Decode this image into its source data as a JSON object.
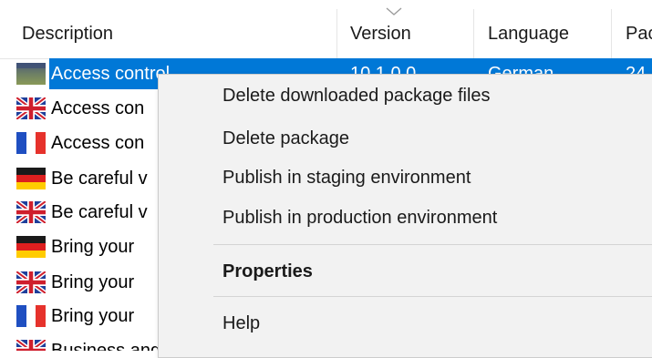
{
  "columns": [
    {
      "label": "Description"
    },
    {
      "label": "Version"
    },
    {
      "label": "Language"
    },
    {
      "label": "Pac"
    }
  ],
  "rows": [
    {
      "description": "Access control",
      "version": "10.1.0.0",
      "language": "German",
      "pack": "24",
      "flag": "multi",
      "selected": true
    },
    {
      "description": "Access con",
      "flag": "uk"
    },
    {
      "description": "Access con",
      "flag": "fr"
    },
    {
      "description": "Be careful v",
      "flag": "de"
    },
    {
      "description": "Be careful v",
      "flag": "uk"
    },
    {
      "description": "Bring your",
      "flag": "de"
    },
    {
      "description": "Bring your",
      "flag": "uk"
    },
    {
      "description": "Bring your",
      "flag": "fr"
    },
    {
      "description": "Business and ...",
      "flag": "uk"
    }
  ],
  "context_menu": {
    "items": [
      {
        "label": "Delete downloaded package files"
      },
      {
        "label": "Delete package"
      },
      {
        "label": "Publish in staging environment"
      },
      {
        "label": "Publish in production environment"
      },
      {
        "label": "Properties",
        "bold": true
      },
      {
        "label": "Help"
      }
    ]
  },
  "colors": {
    "selection": "#0078d7",
    "menu_bg": "#f2f2f2"
  }
}
